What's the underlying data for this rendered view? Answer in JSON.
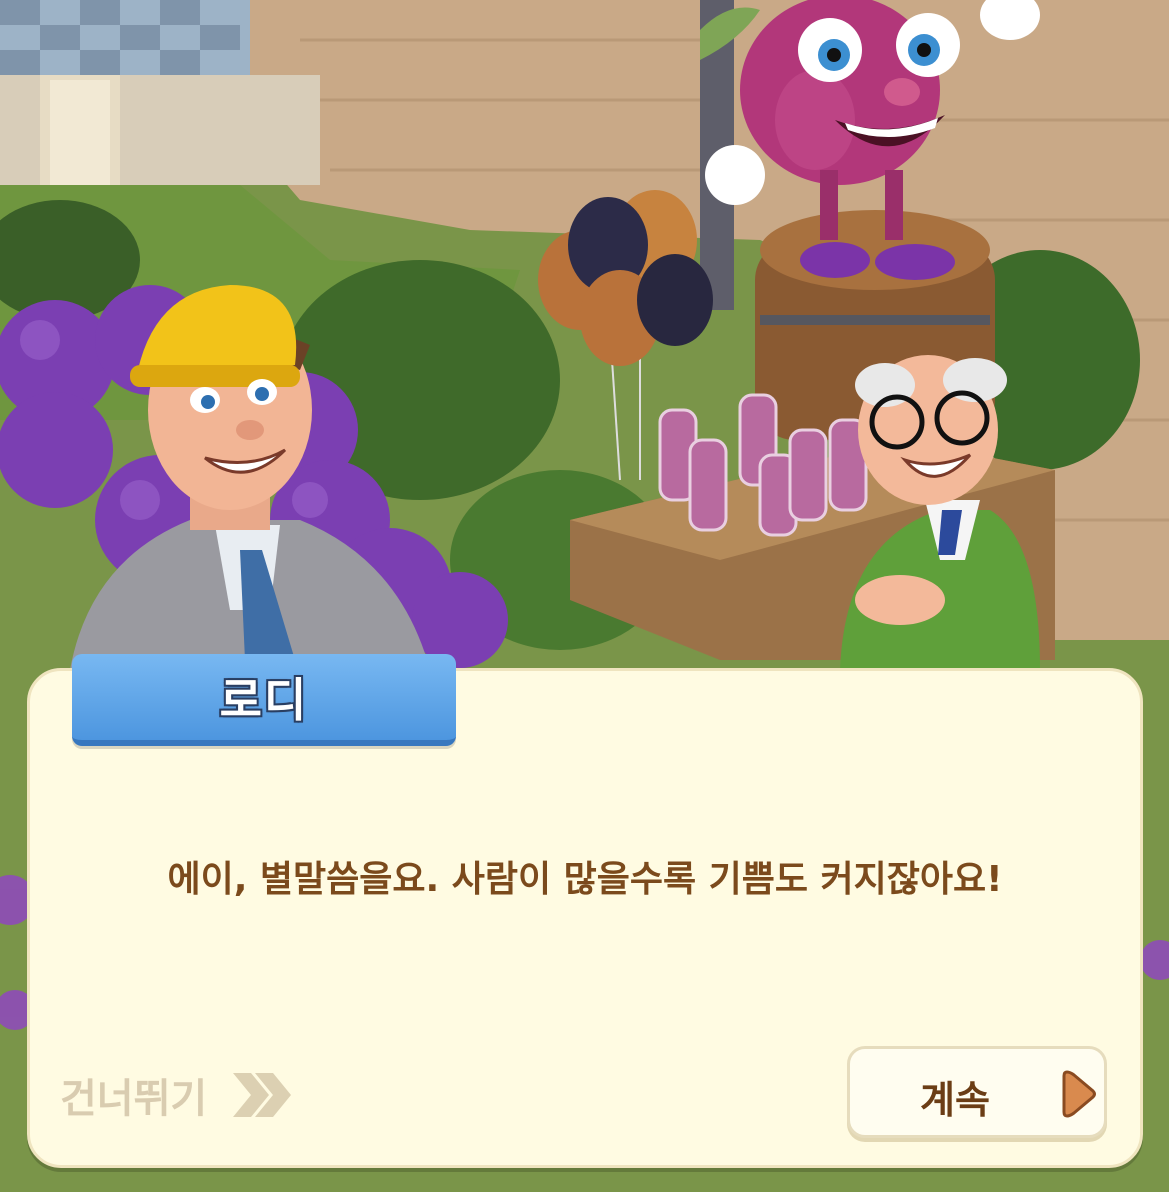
{
  "dialog": {
    "speaker_name": "로디",
    "message": "에이, 별말씀을요. 사람이 많을수록 기쁨도 커지잖아요!",
    "skip_label": "건너뛰기",
    "continue_label": "계속"
  },
  "icons": {
    "skip": "double-chevron-right-icon",
    "continue": "play-triangle-icon"
  },
  "colors": {
    "panel_bg": "#fffbe2",
    "name_tag": "#4d96df",
    "message_text": "#7b4a1c",
    "skip_text": "#d9ccb0",
    "continue_icon": "#d98a4e"
  }
}
